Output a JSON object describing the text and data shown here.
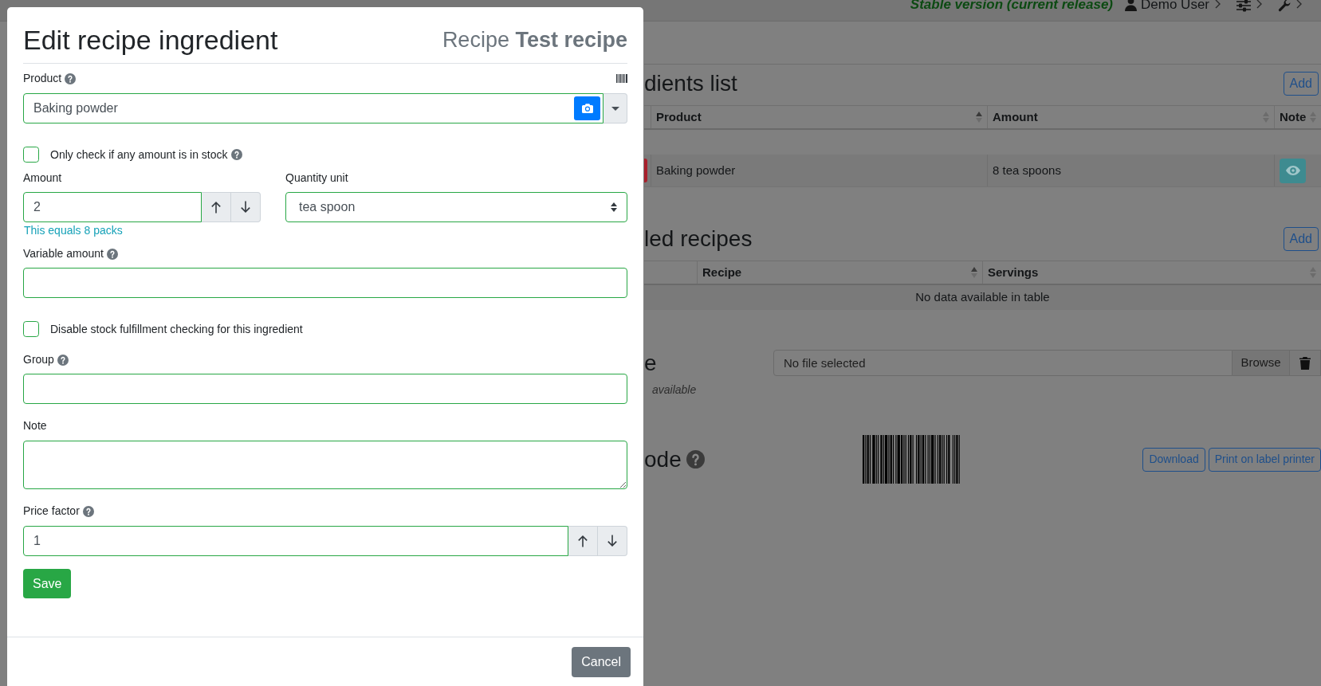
{
  "modal": {
    "title": "Edit recipe ingredient",
    "subtitle": "Recipe **Test recipe**",
    "product": {
      "label": "Product",
      "help": true,
      "value": "Baking powder",
      "valid": true
    },
    "only_check_any_amount": {
      "label": "Only check if any amount is in stock",
      "help": true,
      "checked": false,
      "valid": true
    },
    "amount": {
      "label": "Amount",
      "help": false,
      "value": "2",
      "valid": true,
      "hint": "This equals 8 packs"
    },
    "quantity_unit": {
      "label": "Quantity unit",
      "help": false,
      "value": "tea spoon",
      "valid": true
    },
    "variable_amount": {
      "label": "Variable amount",
      "help": true,
      "valid": true
    },
    "disable_fulfillment_check": {
      "label": "Disable stock fulfillment checking for this ingredient",
      "help": false,
      "checked": false,
      "valid": true
    },
    "group": {
      "label": "Group",
      "help": true,
      "valid": true
    },
    "note": {
      "label": "Note",
      "help": false,
      "valid": true
    },
    "price_factor": {
      "label": "Price factor",
      "help": true,
      "value": "1",
      "valid": true
    },
    "save_button": "Save",
    "cancel_button": "Cancel"
  },
  "page": {
    "top_bar": {
      "version": "Stable version (current release)",
      "user": "Demo User"
    },
    "sections": [
      {
        "kind": "table",
        "title": "dients list",
        "add_button": "Add",
        "columns": [
          {
            "label": "Product",
            "sorted": true
          },
          {
            "label": "Amount",
            "sorted": false
          },
          {
            "label": "Note",
            "sorted": false
          }
        ],
        "rows": [
          {
            "fulfilled": false,
            "cells": [
              "Baking powder",
              "8 tea spoons"
            ],
            "note_button": true
          }
        ]
      },
      {
        "kind": "table",
        "title": "led recipes",
        "add_button": "Add",
        "columns": [
          {
            "label": "Recipe",
            "sorted": true
          },
          {
            "label": "Servings",
            "sorted": false
          }
        ],
        "empty_message": "No data available in table"
      },
      {
        "kind": "file",
        "title": "e",
        "placeholder": "No file selected",
        "browse_button": "Browse",
        "caption": "available"
      },
      {
        "kind": "barcode",
        "title": "ode",
        "help": true,
        "buttons": [
          "Download",
          "Print on label printer"
        ]
      }
    ]
  }
}
